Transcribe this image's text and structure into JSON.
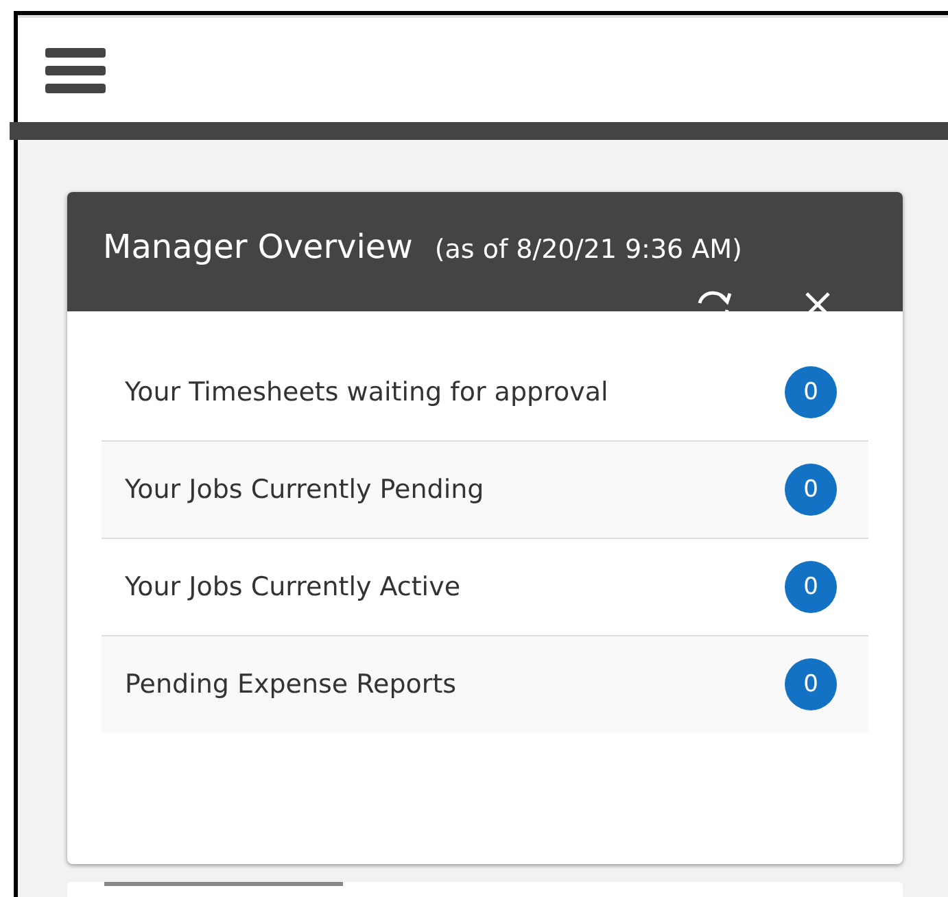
{
  "widget": {
    "title": "Manager Overview",
    "timestamp": "(as of 8/20/21 9:36 AM)",
    "rows": [
      {
        "label": "Your Timesheets waiting for approval",
        "count": "0"
      },
      {
        "label": "Your Jobs Currently Pending",
        "count": "0"
      },
      {
        "label": "Your Jobs Currently Active",
        "count": "0"
      },
      {
        "label": "Pending Expense Reports",
        "count": "0"
      }
    ]
  }
}
